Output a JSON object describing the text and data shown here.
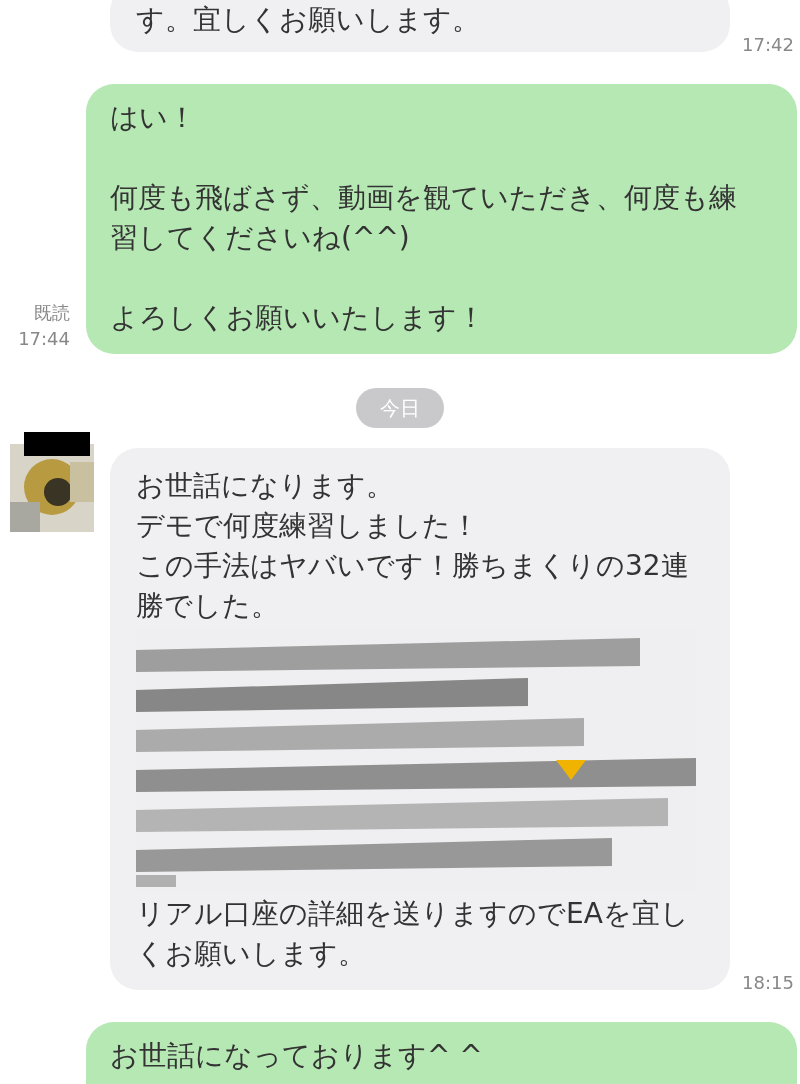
{
  "messages": [
    {
      "kind": "received",
      "text": "す。宜しくお願いします。",
      "time": "17:42"
    },
    {
      "kind": "sent",
      "paragraphs": [
        "はい！",
        "何度も飛ばさず、動画を観ていただき、何度も練習してくださいね(^^)",
        "よろしくお願いいたします！"
      ],
      "read": "既読",
      "time": "17:44"
    },
    {
      "kind": "date",
      "text": "今日"
    },
    {
      "kind": "received",
      "avatar": {
        "kind": "picture"
      },
      "lines": [
        "お世話になります。",
        "デモで何度練習しました！",
        "この手法はヤバいです！勝ちまくりの32連勝でした。"
      ],
      "redacted": {
        "kind": "picture"
      },
      "text_after": "リアル口座の詳細を送りますのでEAを宜しくお願いします。",
      "time": "18:15"
    },
    {
      "kind": "sent",
      "text": "お世話になっております^ ^"
    }
  ]
}
